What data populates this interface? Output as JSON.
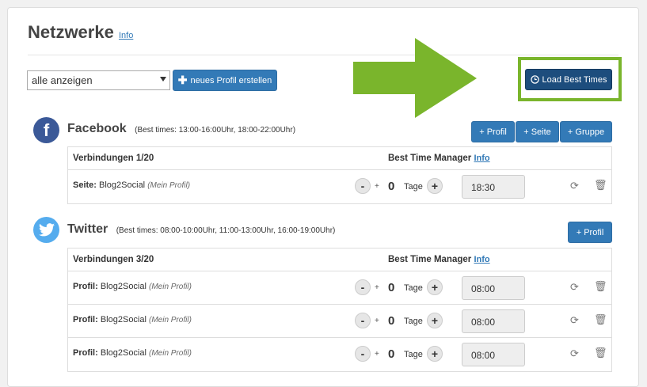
{
  "header": {
    "title": "Netzwerke",
    "info_link": "Info"
  },
  "filter": {
    "selected": "alle anzeigen"
  },
  "buttons": {
    "new_profile": "neues Profil erstellen",
    "load_best_times": "Load Best Times"
  },
  "colors": {
    "arrow": "#7ab52c",
    "primary": "#337ab7",
    "dark_button": "#1d4d7d",
    "facebook": "#3b5998",
    "twitter": "#55acee"
  },
  "facebook": {
    "name": "Facebook",
    "best_times": "(Best times: 13:00-16:00Uhr, 18:00-22:00Uhr)",
    "actions": [
      "+ Profil",
      "+ Seite",
      "+ Gruppe"
    ],
    "connections_label": "Verbindungen 1/20",
    "manager_label": "Best Time Manager",
    "manager_info": "Info",
    "rows": [
      {
        "type": "Seite:",
        "name": "Blog2Social",
        "note": "(Mein Profil)",
        "minus": "-",
        "plus_small": "+",
        "days": "0",
        "days_label": "Tage",
        "plus": "+",
        "time": "18:30"
      }
    ]
  },
  "twitter": {
    "name": "Twitter",
    "best_times": "(Best times: 08:00-10:00Uhr, 11:00-13:00Uhr, 16:00-19:00Uhr)",
    "actions": [
      "+ Profil"
    ],
    "connections_label": "Verbindungen 3/20",
    "manager_label": "Best Time Manager",
    "manager_info": "Info",
    "rows": [
      {
        "type": "Profil:",
        "name": "Blog2Social",
        "note": "(Mein Profil)",
        "minus": "-",
        "plus_small": "+",
        "days": "0",
        "days_label": "Tage",
        "plus": "+",
        "time": "08:00"
      },
      {
        "type": "Profil:",
        "name": "Blog2Social",
        "note": "(Mein Profil)",
        "minus": "-",
        "plus_small": "+",
        "days": "0",
        "days_label": "Tage",
        "plus": "+",
        "time": "08:00"
      },
      {
        "type": "Profil:",
        "name": "Blog2Social",
        "note": "(Mein Profil)",
        "minus": "-",
        "plus_small": "+",
        "days": "0",
        "days_label": "Tage",
        "plus": "+",
        "time": "08:00"
      }
    ]
  },
  "icons": {
    "refresh": "refresh-icon",
    "trash": "trash-icon",
    "clock": "clock-icon",
    "plus": "plus-icon"
  }
}
